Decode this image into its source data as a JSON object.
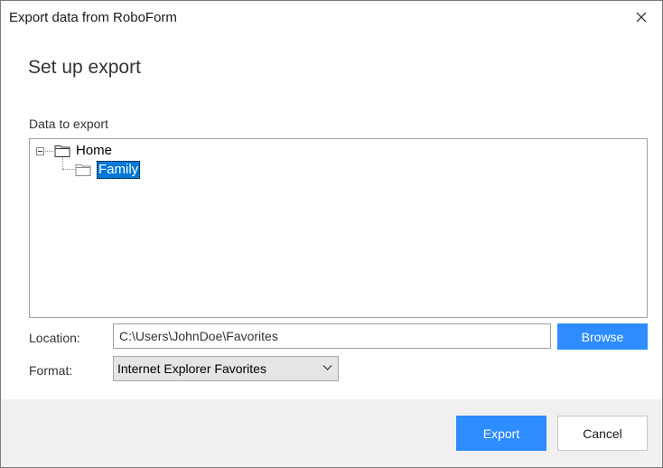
{
  "window": {
    "title": "Export data from RoboForm",
    "close_icon": "close-icon"
  },
  "main": {
    "heading": "Set up export",
    "data_label": "Data to export",
    "tree": {
      "root": {
        "label": "Home",
        "icon": "folder-icon",
        "expanded": true
      },
      "child": {
        "label": "Family",
        "icon": "folder-icon",
        "selected": true
      }
    }
  },
  "location": {
    "label": "Location:",
    "value": "C:\\Users\\JohnDoe\\Favorites",
    "browse_label": "Browse"
  },
  "format": {
    "label": "Format:",
    "selected": "Internet Explorer Favorites"
  },
  "footer": {
    "export_label": "Export",
    "cancel_label": "Cancel"
  },
  "colors": {
    "accent": "#2d8cff",
    "selection": "#0078d7",
    "footer_bg": "#f0f0f0"
  }
}
